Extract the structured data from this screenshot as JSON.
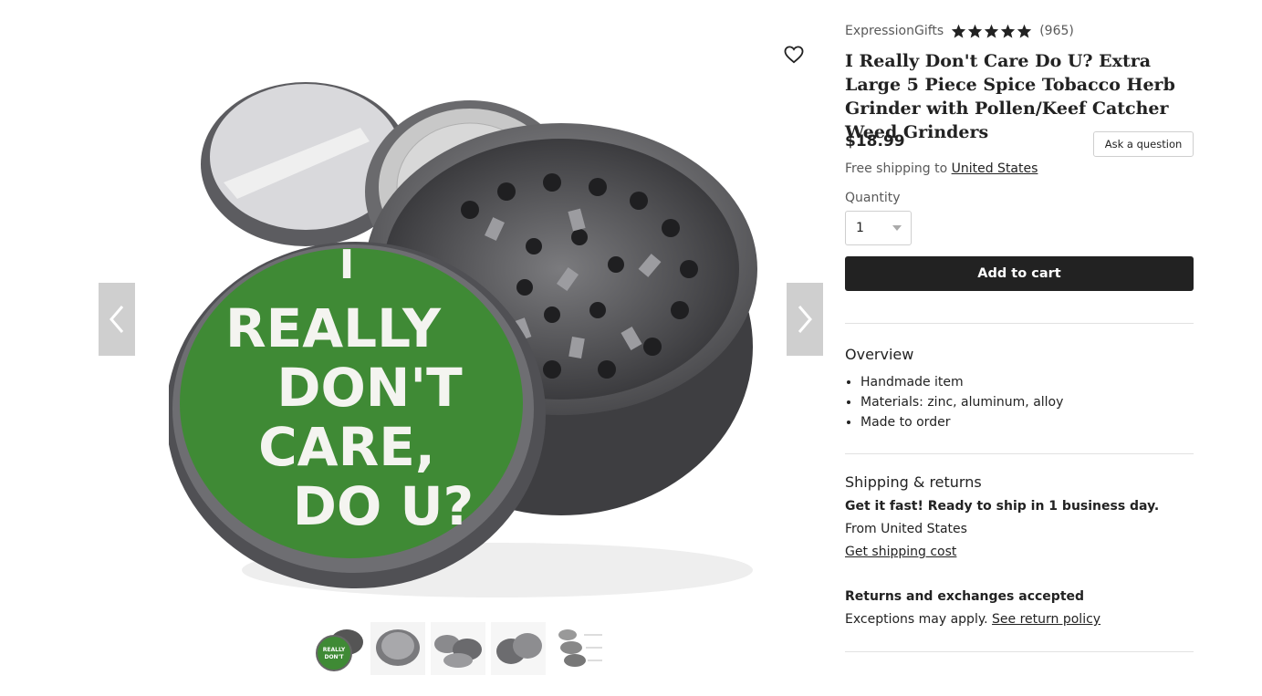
{
  "gallery": {
    "prev_icon": "chevron-left-icon",
    "next_icon": "chevron-right-icon",
    "favorite_icon": "heart-outline-icon",
    "main_image_alt": "I REALLY DON'T CARE, DO U?",
    "main_image_lines": [
      "I",
      "REALLY",
      "DON'T",
      "CARE,",
      "DO U?"
    ],
    "thumbnail_count": 5,
    "active_thumbnail": 1
  },
  "listing": {
    "shop_name": "ExpressionGifts",
    "rating": 5,
    "review_count": "(965)",
    "title": "I Really Don't Care Do U? Extra Large 5 Piece Spice Tobacco Herb Grinder with Pollen/Keef Catcher Weed Grinders",
    "price": "$18.99",
    "ask_question_label": "Ask a question",
    "shipping_prefix": "Free shipping to",
    "shipping_destination": "United States",
    "quantity_label": "Quantity",
    "quantity_value": "1",
    "add_to_cart_label": "Add to cart"
  },
  "overview": {
    "title": "Overview",
    "items": [
      "Handmade item",
      "Materials: zinc, aluminum, alloy",
      "Made to order"
    ]
  },
  "shipping_returns": {
    "title": "Shipping & returns",
    "ready_text": "Get it fast! Ready to ship in 1 business day.",
    "from_text": "From United States",
    "cost_link": "Get shipping cost",
    "returns_title": "Returns and exchanges accepted",
    "exceptions_text": "Exceptions may apply.",
    "policy_link": "See return policy"
  },
  "colors": {
    "accent": "#222222",
    "grinder_green": "#3f8a35",
    "metal": "#6b6b6e"
  }
}
